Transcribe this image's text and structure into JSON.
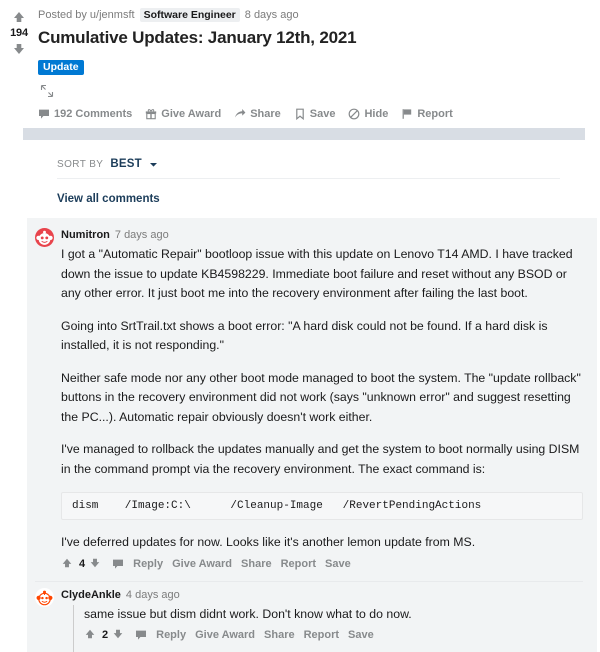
{
  "post": {
    "vote_count": "194",
    "upvote_icon": "upvote-arrow-icon",
    "downvote_icon": "downvote-arrow-icon",
    "posted_by_label": "Posted by",
    "author": "u/jenmsft",
    "author_flair": "Software Engineer",
    "timestamp": "8 days ago",
    "title": "Cumulative Updates: January 12th, 2021",
    "post_flair": "Update",
    "post_flair_color": "#0079d3",
    "expand_icon": "expand-arrows-icon",
    "actions": [
      {
        "label": "192 Comments",
        "icon": "comment-bubble-icon"
      },
      {
        "label": "Give Award",
        "icon": "gift-icon"
      },
      {
        "label": "Share",
        "icon": "share-arrow-icon"
      },
      {
        "label": "Save",
        "icon": "bookmark-icon"
      },
      {
        "label": "Hide",
        "icon": "hide-circle-icon"
      },
      {
        "label": "Report",
        "icon": "flag-icon"
      }
    ]
  },
  "sort": {
    "label": "SORT BY",
    "value": "BEST",
    "chevron_icon": "chevron-down-icon"
  },
  "view_all_comments": "View all comments",
  "comments": [
    {
      "author": "Numitron",
      "timestamp": "7 days ago",
      "avatar_color": "#e8444c",
      "score": "4",
      "paragraphs": [
        "I got a \"Automatic Repair\" bootloop issue with this update on Lenovo T14 AMD. I have tracked down the issue to update KB4598229. Immediate boot failure and reset without any BSOD or any other error. It just boot me into the recovery environment after failing the last boot.",
        "Going into SrtTrail.txt shows a boot error: \"A hard disk could not be found. If a hard disk is installed, it is not responding.\"",
        "Neither safe mode nor any other boot mode managed to boot the system. The \"update rollback\" buttons in the recovery environment did not work (says \"unknown error\" and suggest resetting the PC...). Automatic repair obviously doesn't work either.",
        "I've managed to rollback the updates manually and get the system to boot normally using DISM in the command prompt via the recovery environment. The exact command is:"
      ],
      "code": "dism    /Image:C:\\      /Cleanup-Image   /RevertPendingActions",
      "closing_paragraph": "I've deferred updates for now. Looks like it's another lemon update from MS.",
      "actions": [
        "Reply",
        "Give Award",
        "Share",
        "Report",
        "Save"
      ]
    },
    {
      "author": "ClydeAnkle",
      "timestamp": "4 days ago",
      "avatar_color": "#ff4500",
      "score": "2",
      "paragraphs": [
        "same issue but dism didnt work. Don't know what to do now."
      ],
      "actions": [
        "Reply",
        "Give Award",
        "Share",
        "Report",
        "Save"
      ]
    }
  ]
}
